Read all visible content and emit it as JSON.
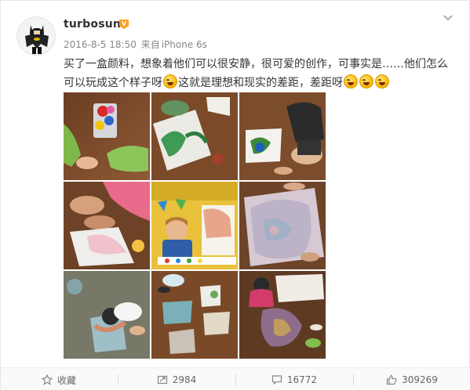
{
  "post": {
    "username": "turbosun",
    "timestamp": "2016-8-5 18:50",
    "source_prefix": "来自",
    "source_device": "iPhone 6s",
    "text_part1": "买了一盒颜料，想象着他们可以很安静，很可爱的创作，可事实是……他们怎么可以玩成这个样子呀",
    "text_part2": "这就是理想和现实的差距，差距呀",
    "emoji_name": "laughing-emoji",
    "photo_count": 9
  },
  "actions": {
    "favorite_label": "收藏",
    "repost_count": "2984",
    "comment_count": "16772",
    "like_count": "309269"
  },
  "colors": {
    "text": "#333333",
    "meta": "#888888",
    "vip_badge": "#f9a01b",
    "action_text": "#666666"
  }
}
